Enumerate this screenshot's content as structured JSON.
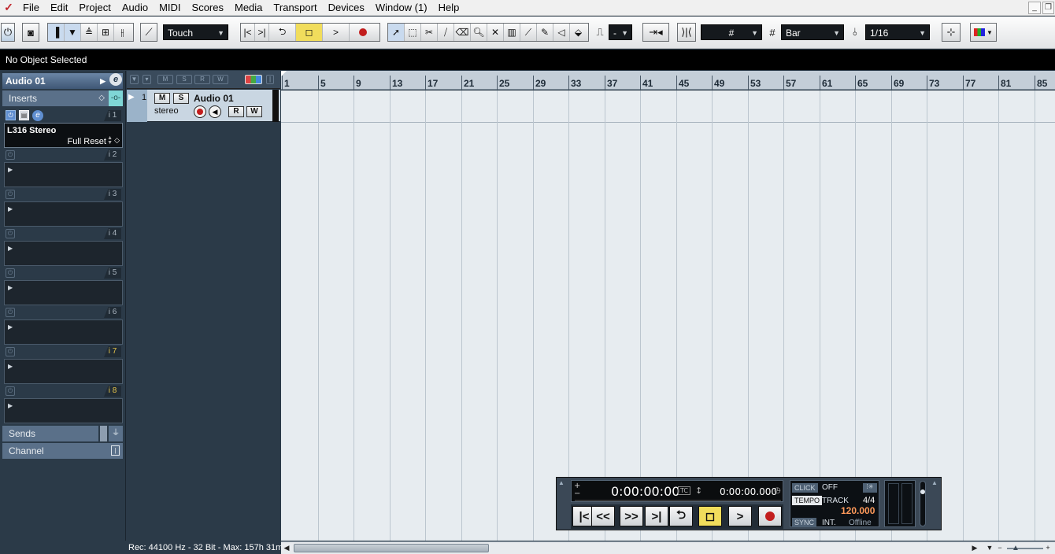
{
  "menu": [
    "File",
    "Edit",
    "Project",
    "Audio",
    "MIDI",
    "Scores",
    "Media",
    "Transport",
    "Devices",
    "Window (1)",
    "Help"
  ],
  "toolbar": {
    "automation_mode": "Touch",
    "track_nudge": "-",
    "grid_type": "Bar",
    "quantize": "1/16"
  },
  "info_line": "No Object Selected",
  "inspector": {
    "track_name": "Audio 01",
    "inserts_label": "Inserts",
    "insert_slots": [
      "i 1",
      "i 2",
      "i 3",
      "i 4",
      "i 5",
      "i 6",
      "i 7",
      "i 8"
    ],
    "slot1_plugin": "L316 Stereo",
    "slot1_preset": "Full Reset",
    "sends_label": "Sends",
    "channel_label": "Channel"
  },
  "track": {
    "number": "1",
    "name": "Audio 01",
    "type": "stereo",
    "mute": "M",
    "solo": "S",
    "read": "R",
    "write": "W"
  },
  "ruler": [
    "1",
    "5",
    "9",
    "13",
    "17",
    "21",
    "25",
    "29",
    "33",
    "37",
    "41",
    "45",
    "49",
    "53",
    "57",
    "61",
    "65",
    "69",
    "73",
    "77",
    "81",
    "85"
  ],
  "status": "Rec: 44100 Hz - 32 Bit - Max: 157h 31m",
  "transport": {
    "primary_time": "0:00:00:00",
    "primary_format": "TC",
    "secondary_time": "0:00:00.000",
    "click_label": "CLICK",
    "click_value": "OFF",
    "tempo_label": "TEMPO",
    "tempo_mode": "TRACK",
    "signature": "4/4",
    "tempo": "120.000",
    "sync_label": "SYNC",
    "sync_mode": "INT.",
    "sync_status": "Offline"
  },
  "colors": {
    "inspector_bg": "#2b3a48",
    "track_bg": "#c9d6e2",
    "grid_bg": "#e7ecf0",
    "record": "#c21d1d",
    "stop_active": "#f1dd5c",
    "tempo_value": "#ff9a5a"
  }
}
